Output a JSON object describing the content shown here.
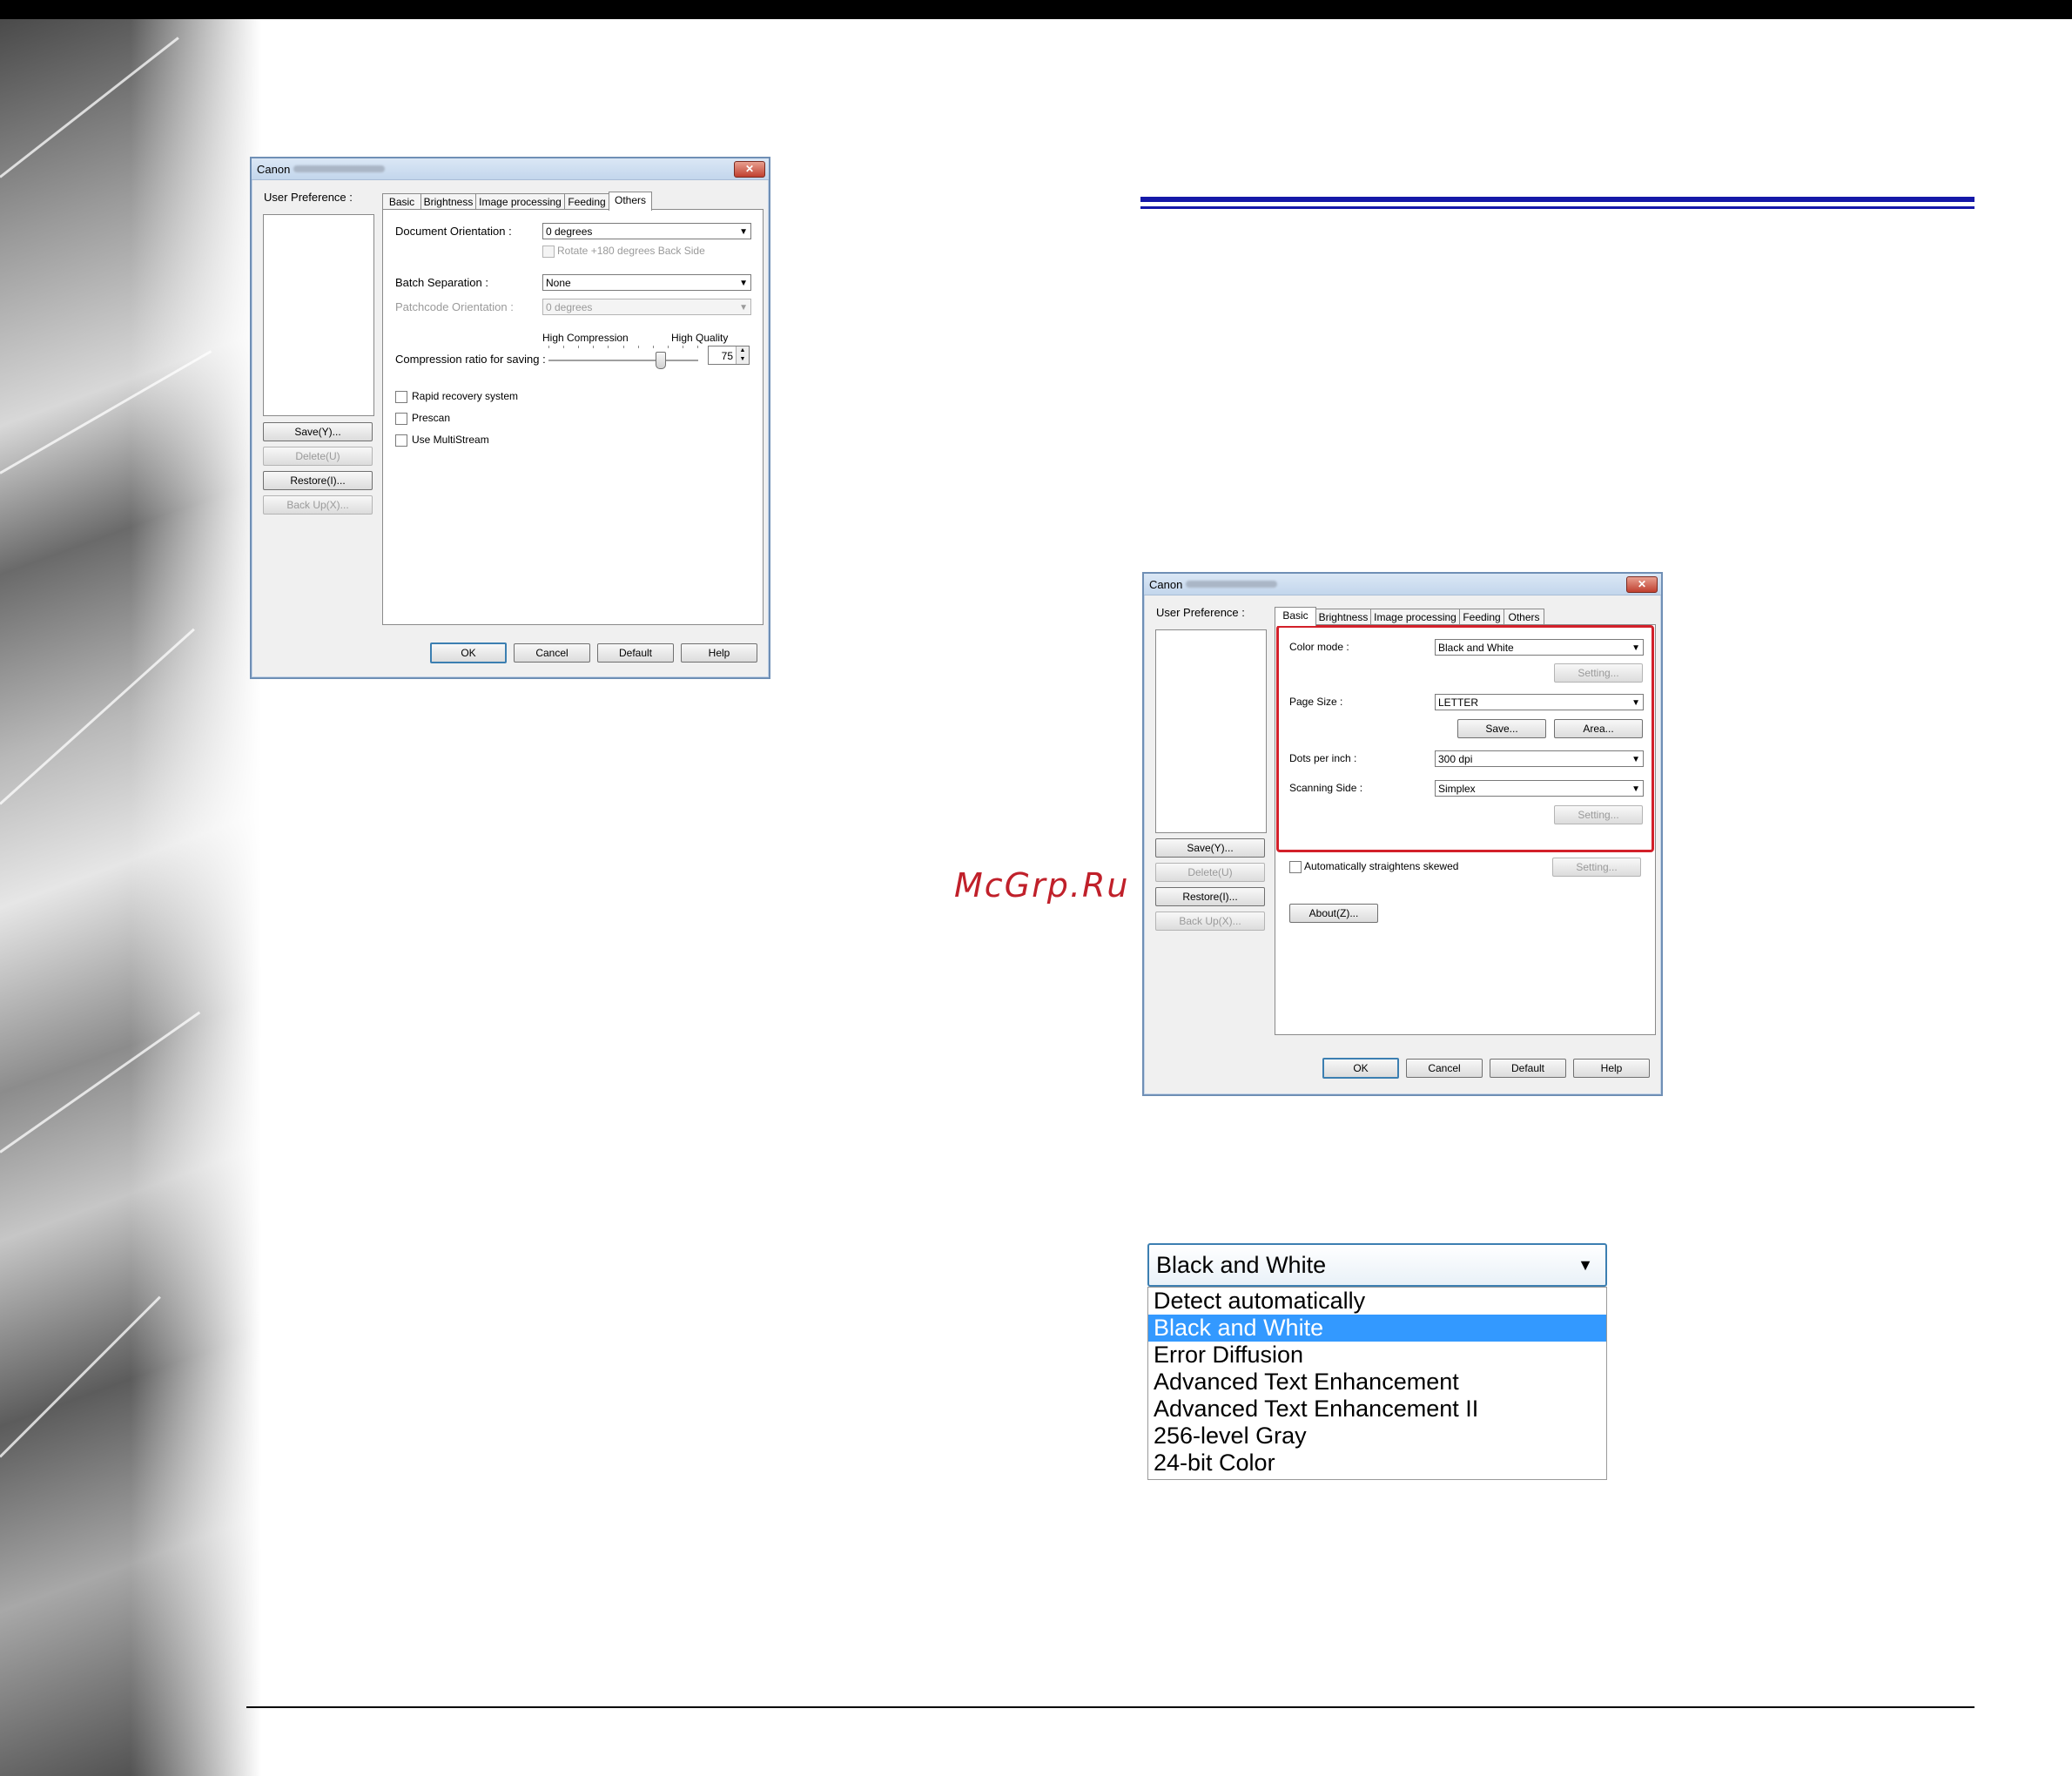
{
  "watermark": "McGrp.Ru",
  "dialog_others": {
    "title": "Canon",
    "user_preference_label": "User Preference :",
    "side_buttons": [
      {
        "label": "Save(Y)...",
        "enabled": true
      },
      {
        "label": "Delete(U)",
        "enabled": false
      },
      {
        "label": "Restore(I)...",
        "enabled": true
      },
      {
        "label": "Back Up(X)...",
        "enabled": false
      }
    ],
    "tabs": [
      "Basic",
      "Brightness",
      "Image processing",
      "Feeding",
      "Others"
    ],
    "active_tab": "Others",
    "document_orientation_label": "Document Orientation :",
    "document_orientation_value": "0 degrees",
    "rotate_back_label": "Rotate +180 degrees Back Side",
    "batch_separation_label": "Batch Separation :",
    "batch_separation_value": "None",
    "patchcode_orientation_label": "Patchcode Orientation :",
    "patchcode_orientation_value": "0 degrees",
    "high_compression_label": "High Compression",
    "high_quality_label": "High Quality",
    "compression_label": "Compression ratio for saving :",
    "compression_value": "75",
    "compression_slider_fraction": 0.75,
    "checkboxes": [
      "Rapid recovery system",
      "Prescan",
      "Use MultiStream"
    ],
    "bottom_buttons": [
      "OK",
      "Cancel",
      "Default",
      "Help"
    ]
  },
  "dialog_basic": {
    "title": "Canon",
    "user_preference_label": "User Preference :",
    "side_buttons": [
      {
        "label": "Save(Y)...",
        "enabled": true
      },
      {
        "label": "Delete(U)",
        "enabled": false
      },
      {
        "label": "Restore(I)...",
        "enabled": true
      },
      {
        "label": "Back Up(X)...",
        "enabled": false
      }
    ],
    "tabs": [
      "Basic",
      "Brightness",
      "Image processing",
      "Feeding",
      "Others"
    ],
    "active_tab": "Basic",
    "color_mode_label": "Color mode :",
    "color_mode_value": "Black and White",
    "setting_label": "Setting...",
    "page_size_label": "Page Size :",
    "page_size_value": "LETTER",
    "save_label": "Save...",
    "area_label": "Area...",
    "dpi_label": "Dots per inch :",
    "dpi_value": "300 dpi",
    "scanning_side_label": "Scanning Side :",
    "scanning_side_value": "Simplex",
    "auto_straighten_label": "Automatically straightens skewed",
    "about_label": "About(Z)...",
    "bottom_buttons": [
      "OK",
      "Cancel",
      "Default",
      "Help"
    ],
    "highlight_color": "#d3202a"
  },
  "color_mode_dropdown": {
    "selected": "Black and White",
    "options": [
      "Detect automatically",
      "Black and White",
      "Error Diffusion",
      "Advanced Text Enhancement",
      "Advanced Text Enhancement II",
      "256-level Gray",
      "24-bit Color"
    ],
    "highlight_color": "#3399ff"
  },
  "colors": {
    "title_rule": "#1418a8",
    "watermark": "#c0202a"
  }
}
